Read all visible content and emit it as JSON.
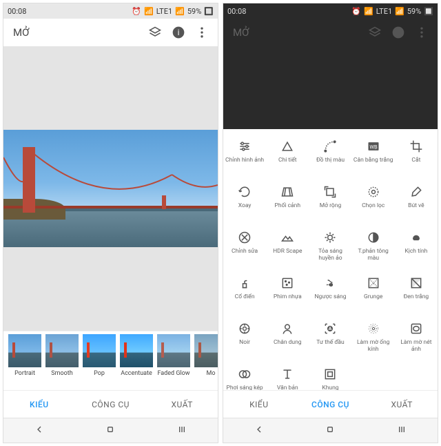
{
  "statusbar": {
    "time": "00:08",
    "network": "LTE1",
    "battery": "59%"
  },
  "header": {
    "open_label": "MỞ"
  },
  "filters": [
    {
      "label": "Portrait"
    },
    {
      "label": "Smooth"
    },
    {
      "label": "Pop"
    },
    {
      "label": "Accentuate"
    },
    {
      "label": "Faded Glow"
    },
    {
      "label": "Mo"
    }
  ],
  "tabs": {
    "styles": "KIỂU",
    "tools": "CÔNG CỤ",
    "export": "XUẤT"
  },
  "tools": [
    {
      "label": "Chỉnh hình ảnh",
      "icon": "tune"
    },
    {
      "label": "Chi tiết",
      "icon": "triangle"
    },
    {
      "label": "Đồ thị màu",
      "icon": "curves"
    },
    {
      "label": "Cân bằng trắng",
      "icon": "wb"
    },
    {
      "label": "Cắt",
      "icon": "crop"
    },
    {
      "label": "Xoay",
      "icon": "rotate"
    },
    {
      "label": "Phối cảnh",
      "icon": "perspective"
    },
    {
      "label": "Mở rộng",
      "icon": "expand"
    },
    {
      "label": "Chọn lọc",
      "icon": "selective"
    },
    {
      "label": "Bút vẽ",
      "icon": "brush"
    },
    {
      "label": "Chỉnh sửa",
      "icon": "heal"
    },
    {
      "label": "HDR Scape",
      "icon": "hdr"
    },
    {
      "label": "Tỏa sáng huyền ảo",
      "icon": "glow"
    },
    {
      "label": "T.phản tông màu",
      "icon": "tonal"
    },
    {
      "label": "Kịch tính",
      "icon": "drama"
    },
    {
      "label": "Cổ điển",
      "icon": "vintage"
    },
    {
      "label": "Phim nhựa",
      "icon": "grainy"
    },
    {
      "label": "Ngược sáng",
      "icon": "retrolux"
    },
    {
      "label": "Grunge",
      "icon": "grunge"
    },
    {
      "label": "Đen trắng",
      "icon": "bw"
    },
    {
      "label": "Noir",
      "icon": "noir"
    },
    {
      "label": "Chân dung",
      "icon": "portrait"
    },
    {
      "label": "Tư thế đầu",
      "icon": "headpose"
    },
    {
      "label": "Làm mờ ống kính",
      "icon": "lensblur"
    },
    {
      "label": "Làm mờ nét ảnh",
      "icon": "vignette"
    },
    {
      "label": "Phơi sáng kép",
      "icon": "double"
    },
    {
      "label": "Văn bản",
      "icon": "text"
    },
    {
      "label": "Khung",
      "icon": "frame"
    }
  ]
}
